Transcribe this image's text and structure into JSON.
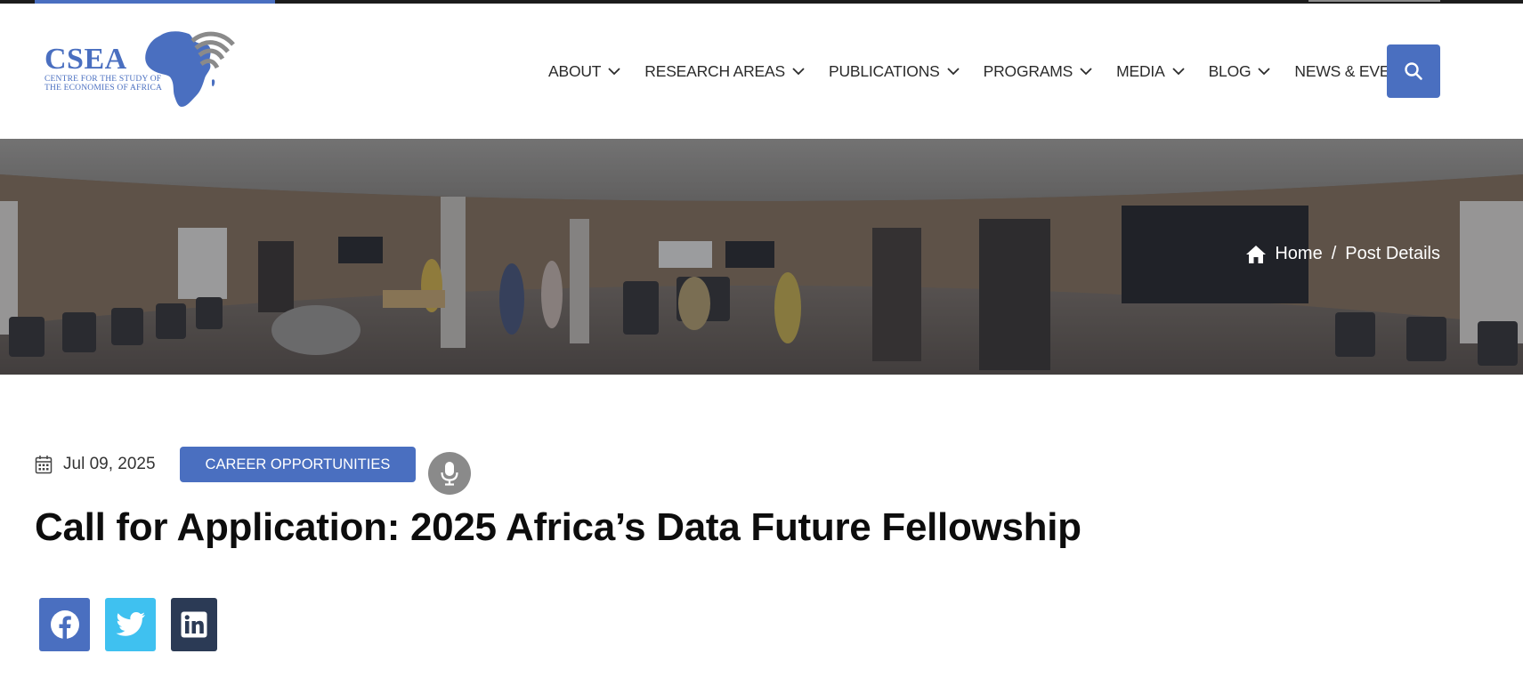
{
  "logo": {
    "name": "CSEA",
    "subtitle_line1": "CENTRE FOR THE STUDY OF",
    "subtitle_line2": "THE ECONOMIES OF AFRICA"
  },
  "nav": {
    "items": [
      {
        "label": "ABOUT"
      },
      {
        "label": "RESEARCH AREAS"
      },
      {
        "label": "PUBLICATIONS"
      },
      {
        "label": "PROGRAMS"
      },
      {
        "label": "MEDIA"
      },
      {
        "label": "BLOG"
      },
      {
        "label": "NEWS & EVENTS"
      }
    ],
    "search_icon": "search-icon"
  },
  "breadcrumb": {
    "home": "Home",
    "separator": "/",
    "current": "Post Details"
  },
  "post": {
    "date": "Jul 09, 2025",
    "category": "CAREER OPPORTUNITIES",
    "title": "Call for Application: 2025 Africa’s Data Future Fellowship"
  },
  "share": {
    "icons": [
      "facebook-icon",
      "twitter-icon",
      "linkedin-icon"
    ]
  },
  "colors": {
    "brand_blue": "#4a6fc0",
    "twitter_blue": "#3fc1f0",
    "linkedin_navy": "#2b3a55",
    "mic_gray": "#8a8a8a"
  }
}
